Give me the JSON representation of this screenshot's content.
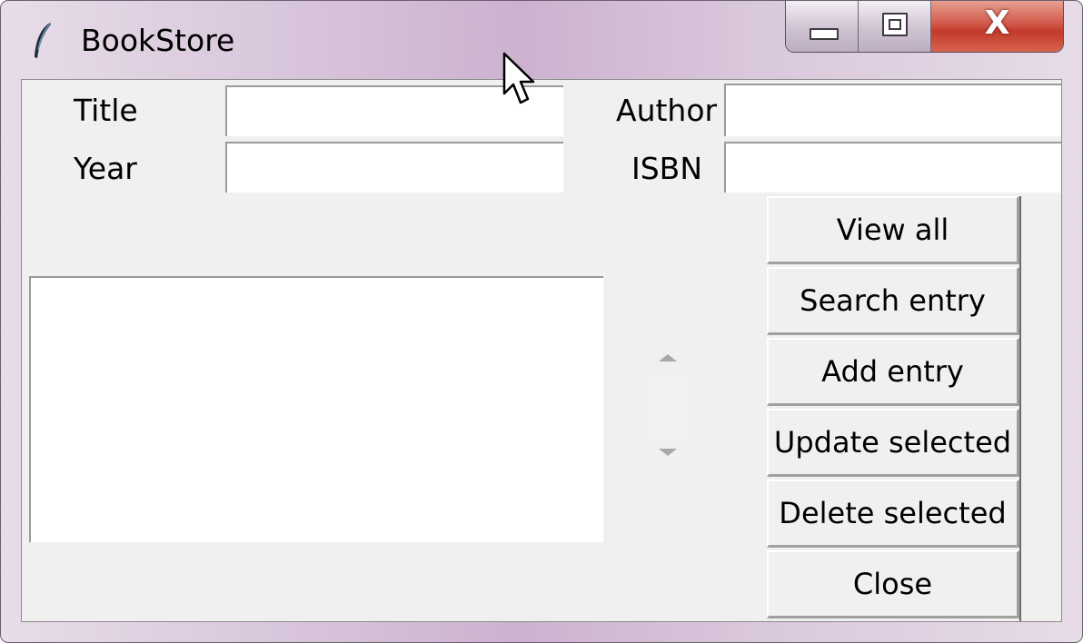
{
  "window": {
    "title": "BookStore",
    "app_icon": "feather-icon",
    "caption_buttons": {
      "minimize_icon": "minimize-icon",
      "maximize_icon": "maximize-icon",
      "close_glyph": "X"
    },
    "accent_close_color": "#c8402f"
  },
  "form": {
    "title_label": "Title",
    "author_label": "Author",
    "year_label": "Year",
    "isbn_label": "ISBN",
    "title_value": "",
    "author_value": "",
    "year_value": "",
    "isbn_value": ""
  },
  "results_list": {
    "items": []
  },
  "buttons": {
    "view_all": "View all",
    "search_entry": "Search entry",
    "add_entry": "Add entry",
    "update_selected": "Update selected",
    "delete_selected": "Delete selected",
    "close": "Close"
  },
  "icons": {
    "scroll_up": "scroll-up-arrow-icon",
    "scroll_down": "scroll-down-arrow-icon",
    "cursor": "mouse-pointer-icon"
  }
}
